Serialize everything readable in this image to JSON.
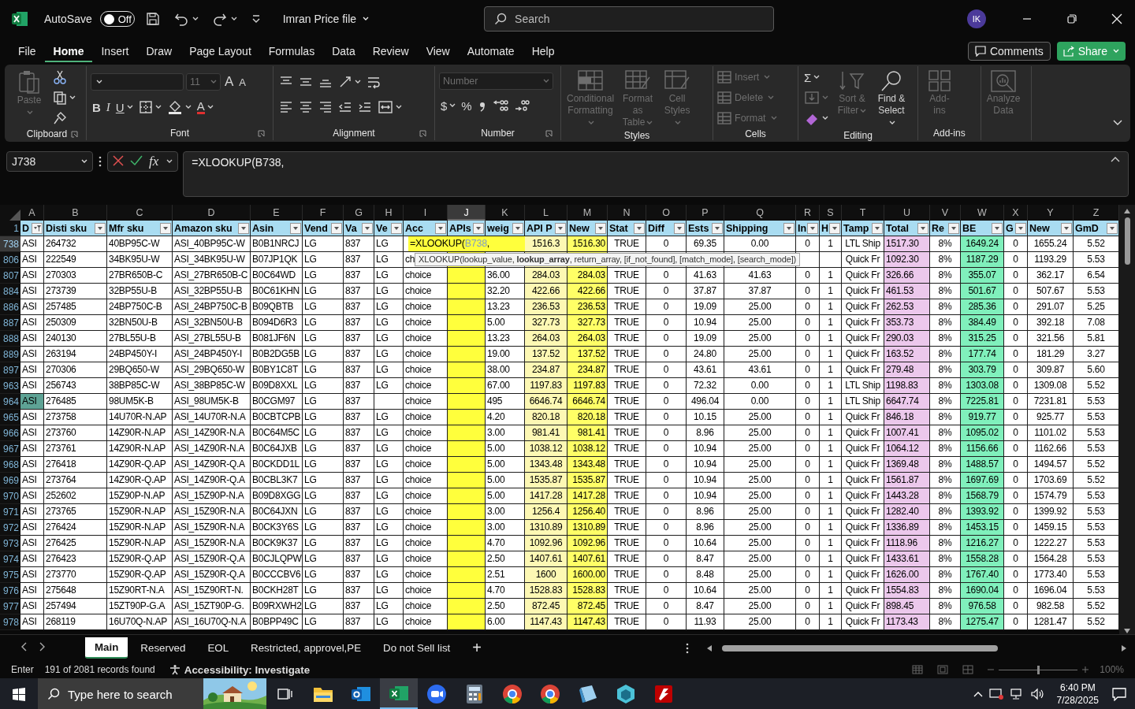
{
  "title_bar": {
    "autosave_label": "AutoSave",
    "autosave": {
      "on": false,
      "label": "Off"
    },
    "file_name": "Imran Price file",
    "search": {
      "placeholder": "Search"
    },
    "avatar": "IK"
  },
  "menu_tabs": [
    {
      "label": "File",
      "selected": false
    },
    {
      "label": "Home",
      "selected": true
    },
    {
      "label": "Insert",
      "selected": false
    },
    {
      "label": "Draw",
      "selected": false
    },
    {
      "label": "Page Layout",
      "selected": false
    },
    {
      "label": "Formulas",
      "selected": false
    },
    {
      "label": "Data",
      "selected": false
    },
    {
      "label": "Review",
      "selected": false
    },
    {
      "label": "View",
      "selected": false
    },
    {
      "label": "Automate",
      "selected": false
    },
    {
      "label": "Help",
      "selected": false
    }
  ],
  "comments_button": "Comments",
  "share_button": "Share",
  "ribbon": {
    "groups": [
      {
        "label": "Clipboard",
        "launcher": true,
        "columns": [
          [
            {
              "kind": "paste",
              "label": "Paste",
              "disabled": true,
              "dropdown": true
            }
          ],
          [
            {
              "kind": "cut",
              "disabled": false,
              "dropdown": false
            },
            {
              "kind": "copy",
              "disabled": false,
              "dropdown": true
            },
            {
              "kind": "format-painter",
              "disabled": false,
              "dropdown": false
            }
          ]
        ]
      },
      {
        "label": "Font",
        "launcher": true,
        "rows": [
          [
            {
              "kind": "font-name-field",
              "disabled": false,
              "dropdown": true
            },
            {
              "kind": "font-size-field",
              "value": "11",
              "disabled": true,
              "dropdown": true
            },
            {
              "kind": "grow",
              "text": "A",
              "disabled": false,
              "dropdown": false
            },
            {
              "kind": "shrink",
              "text": "A",
              "disabled": false,
              "dropdown": false
            }
          ],
          [
            {
              "kind": "bold",
              "text": "B",
              "disabled": false,
              "dropdown": false
            },
            {
              "kind": "italic",
              "text": "I",
              "disabled": false,
              "dropdown": false
            },
            {
              "kind": "underline",
              "text": "U",
              "disabled": false,
              "dropdown": true
            },
            {
              "kind": "borders",
              "disabled": false,
              "dropdown": true
            },
            {
              "kind": "fill-color",
              "disabled": false,
              "dropdown": true
            },
            {
              "kind": "font-color",
              "text": "A",
              "disabled": false,
              "dropdown": true
            }
          ]
        ]
      },
      {
        "label": "Alignment",
        "launcher": true,
        "rows": [
          [
            {
              "kind": "align-top",
              "disabled": false,
              "dropdown": false
            },
            {
              "kind": "align-middle",
              "disabled": false,
              "dropdown": false
            },
            {
              "kind": "align-bottom",
              "disabled": false,
              "dropdown": false
            },
            {
              "kind": "orientation",
              "disabled": false,
              "dropdown": true
            },
            {
              "kind": "wrap-text",
              "disabled": false,
              "dropdown": false
            }
          ],
          [
            {
              "kind": "align-left",
              "disabled": false,
              "dropdown": false
            },
            {
              "kind": "align-center",
              "disabled": false,
              "dropdown": false
            },
            {
              "kind": "align-right",
              "disabled": false,
              "dropdown": false
            },
            {
              "kind": "decrease-indent",
              "disabled": false,
              "dropdown": false
            },
            {
              "kind": "increase-indent",
              "disabled": false,
              "dropdown": false
            },
            {
              "kind": "merge",
              "disabled": false,
              "dropdown": true
            }
          ]
        ]
      },
      {
        "label": "Number",
        "launcher": true,
        "rows": [
          [
            {
              "kind": "format-field",
              "value": "Number",
              "disabled": true,
              "dropdown": true
            }
          ],
          [
            {
              "kind": "currency",
              "text": "$",
              "disabled": false,
              "dropdown": true
            },
            {
              "kind": "percent",
              "text": "%",
              "disabled": false,
              "dropdown": false
            },
            {
              "kind": "comma",
              "disabled": false,
              "dropdown": false
            },
            {
              "kind": "increase-decimal",
              "disabled": false,
              "dropdown": false
            },
            {
              "kind": "decrease-decimal",
              "disabled": false,
              "dropdown": false
            }
          ]
        ]
      },
      {
        "label": "Styles",
        "launcher": false,
        "columns": [
          [
            {
              "kind": "conditional-formatting",
              "label": "Conditional Formatting",
              "disabled": true,
              "dropdown": true
            }
          ],
          [
            {
              "kind": "format-as-table",
              "label": "Format as Table",
              "disabled": true,
              "dropdown": true
            }
          ],
          [
            {
              "kind": "cell-styles",
              "label": "Cell Styles",
              "disabled": true,
              "dropdown": true
            }
          ]
        ]
      },
      {
        "label": "Cells",
        "launcher": false,
        "columns": [
          [
            {
              "kind": "insert",
              "label": "Insert",
              "disabled": true,
              "dropdown": true
            },
            {
              "kind": "delete",
              "label": "Delete",
              "disabled": true,
              "dropdown": true
            },
            {
              "kind": "format",
              "label": "Format",
              "disabled": true,
              "dropdown": true
            }
          ]
        ]
      },
      {
        "label": "Editing",
        "launcher": false,
        "columns": [
          [
            {
              "kind": "autosum",
              "text": "Σ",
              "disabled": false,
              "dropdown": true
            },
            {
              "kind": "fill",
              "disabled": true,
              "dropdown": true
            },
            {
              "kind": "clear",
              "disabled": false,
              "dropdown": true
            }
          ],
          [
            {
              "kind": "sort-filter",
              "label": "Sort & Filter",
              "disabled": true,
              "dropdown": true
            }
          ],
          [
            {
              "kind": "find-select",
              "label": "Find & Select",
              "disabled": false,
              "dropdown": true
            }
          ]
        ]
      },
      {
        "label": "Add-ins",
        "launcher": false,
        "columns": [
          [
            {
              "kind": "add-ins",
              "label": "Add-ins",
              "disabled": true,
              "dropdown": false
            }
          ]
        ]
      },
      {
        "columns": [
          [
            {
              "kind": "analyze-data",
              "label": "Analyze Data",
              "disabled": true,
              "dropdown": false
            }
          ]
        ]
      }
    ]
  },
  "formula_bar": {
    "name_box": "J738",
    "function_button": "fx",
    "formula": "=XLOOKUP(B738,"
  },
  "table": {
    "header_row_number": "1",
    "columns": [
      {
        "letter": "A",
        "header": "D",
        "filtered": true,
        "selected": false
      },
      {
        "letter": "B",
        "header": "Disti sku",
        "filtered": false,
        "selected": false
      },
      {
        "letter": "C",
        "header": "Mfr sku",
        "filtered": false,
        "selected": false
      },
      {
        "letter": "D",
        "header": "Amazon sku",
        "filtered": false,
        "selected": false
      },
      {
        "letter": "E",
        "header": "Asin",
        "filtered": false,
        "selected": false
      },
      {
        "letter": "F",
        "header": "Vend",
        "filtered": false,
        "selected": false
      },
      {
        "letter": "G",
        "header": "Va",
        "filtered": false,
        "selected": false
      },
      {
        "letter": "H",
        "header": "Ve",
        "filtered": false,
        "selected": false
      },
      {
        "letter": "I",
        "header": "Acc",
        "filtered": false,
        "selected": false
      },
      {
        "letter": "J",
        "header": "APIs",
        "filtered": false,
        "selected": true,
        "color": "#ffff3c"
      },
      {
        "letter": "K",
        "header": "weig",
        "filtered": false,
        "selected": false
      },
      {
        "letter": "L",
        "header": "API P",
        "filtered": false,
        "selected": false,
        "color": "#fdf8b4"
      },
      {
        "letter": "M",
        "header": "New",
        "filtered": false,
        "selected": false,
        "color": "#ffff66"
      },
      {
        "letter": "N",
        "header": "Stat",
        "filtered": false,
        "selected": false
      },
      {
        "letter": "O",
        "header": "Diff",
        "filtered": false,
        "selected": false
      },
      {
        "letter": "P",
        "header": "Ests",
        "filtered": false,
        "selected": false
      },
      {
        "letter": "Q",
        "header": "Shipping",
        "filtered": false,
        "selected": false
      },
      {
        "letter": "R",
        "header": "In",
        "filtered": false,
        "selected": false
      },
      {
        "letter": "S",
        "header": "H",
        "filtered": false,
        "selected": false
      },
      {
        "letter": "T",
        "header": "Tamp",
        "filtered": false,
        "selected": false
      },
      {
        "letter": "U",
        "header": "Total",
        "filtered": false,
        "selected": false,
        "color": "#ecc8ec"
      },
      {
        "letter": "V",
        "header": "Re",
        "filtered": false,
        "selected": false
      },
      {
        "letter": "W",
        "header": "BE",
        "filtered": false,
        "selected": false,
        "color": "#80f0bc"
      },
      {
        "letter": "X",
        "header": "G",
        "filtered": false,
        "selected": false
      },
      {
        "letter": "Y",
        "header": "New",
        "filtered": false,
        "selected": false
      },
      {
        "letter": "Z",
        "header": "GmD",
        "filtered": false,
        "selected": false
      }
    ],
    "rows": [
      {
        "number": "738",
        "selected": true,
        "highlighted": false,
        "editor": {
          "text_before": "=XLOOKUP(",
          "reference": "B738",
          "text_after": ","
        },
        "cells": [
          "ASI",
          "264732",
          "40BP95C-W",
          "ASI_40BP95C-W",
          "B0B1NRCJ",
          "LG",
          "837",
          "LG",
          null,
          null,
          null,
          "1516.3",
          "1516.30",
          "TRUE",
          "0",
          "69.35",
          "0.00",
          "0",
          "1",
          "LTL Ship",
          "1517.30",
          "8%",
          "1649.24",
          "0",
          "1655.24",
          "5.52"
        ]
      },
      {
        "number": "806",
        "selected": false,
        "highlighted": false,
        "tooltip": "XLOOKUP(lookup_value, **lookup_array**, return_array, [if_not_found], [match_mode], [search_mode])",
        "cells": [
          "ASI",
          "222549",
          "34BK95U-W",
          "ASI_34BK95U-W",
          "B07JP1QK",
          "LG",
          "837",
          "LG",
          "ch",
          null,
          null,
          null,
          null,
          null,
          null,
          null,
          null,
          null,
          null,
          "Quick Fr",
          "1092.30",
          "8%",
          "1187.29",
          "0",
          "1193.29",
          "5.53"
        ]
      },
      {
        "number": "807",
        "selected": false,
        "highlighted": false,
        "cells": [
          "ASI",
          "270303",
          "27BR650B-C",
          "ASI_27BR650B-C",
          "B0C64WD",
          "LG",
          "837",
          "LG",
          "choice",
          null,
          "36.00",
          "284.03",
          "284.03",
          "TRUE",
          "0",
          "41.63",
          "41.63",
          "0",
          "1",
          "Quick Fr",
          "326.66",
          "8%",
          "355.07",
          "0",
          "362.17",
          "6.54"
        ]
      },
      {
        "number": "884",
        "selected": false,
        "highlighted": false,
        "cells": [
          "ASI",
          "273739",
          "32BP55U-B",
          "ASI_32BP55U-B",
          "B0C61KHN",
          "LG",
          "837",
          "LG",
          "choice",
          null,
          "32.20",
          "422.66",
          "422.66",
          "TRUE",
          "0",
          "37.87",
          "37.87",
          "0",
          "1",
          "Quick Fr",
          "461.53",
          "8%",
          "501.67",
          "0",
          "507.67",
          "5.53"
        ]
      },
      {
        "number": "886",
        "selected": false,
        "highlighted": false,
        "cells": [
          "ASI",
          "257485",
          "24BP750C-B",
          "ASI_24BP750C-B",
          "B09QBTB",
          "LG",
          "837",
          "LG",
          "choice",
          null,
          "13.23",
          "236.53",
          "236.53",
          "TRUE",
          "0",
          "19.09",
          "25.00",
          "0",
          "1",
          "Quick Fr",
          "262.53",
          "8%",
          "285.36",
          "0",
          "291.07",
          "5.25"
        ]
      },
      {
        "number": "887",
        "selected": false,
        "highlighted": false,
        "cells": [
          "ASI",
          "250309",
          "32BN50U-B",
          "ASI_32BN50U-B",
          "B094D6R3",
          "LG",
          "837",
          "LG",
          "choice",
          null,
          "5.00",
          "327.73",
          "327.73",
          "TRUE",
          "0",
          "10.94",
          "25.00",
          "0",
          "1",
          "Quick Fr",
          "353.73",
          "8%",
          "384.49",
          "0",
          "392.18",
          "7.08"
        ]
      },
      {
        "number": "888",
        "selected": false,
        "highlighted": false,
        "cells": [
          "ASI",
          "240130",
          "27BL55U-B",
          "ASI_27BL55U-B",
          "B081JF6N",
          "LG",
          "837",
          "LG",
          "choice",
          null,
          "13.23",
          "264.03",
          "264.03",
          "TRUE",
          "0",
          "19.09",
          "25.00",
          "0",
          "1",
          "Quick Fr",
          "290.03",
          "8%",
          "315.25",
          "0",
          "321.56",
          "5.81"
        ]
      },
      {
        "number": "889",
        "selected": false,
        "highlighted": false,
        "cells": [
          "ASI",
          "263194",
          "24BP450Y-I",
          "ASI_24BP450Y-I",
          "B0B2DG5B",
          "LG",
          "837",
          "LG",
          "choice",
          null,
          "19.00",
          "137.52",
          "137.52",
          "TRUE",
          "0",
          "24.80",
          "25.00",
          "0",
          "1",
          "Quick Fr",
          "163.52",
          "8%",
          "177.74",
          "0",
          "181.29",
          "3.27"
        ]
      },
      {
        "number": "897",
        "selected": false,
        "highlighted": false,
        "cells": [
          "ASI",
          "270306",
          "29BQ650-W",
          "ASI_29BQ650-W",
          "B0BY1C8T",
          "LG",
          "837",
          "LG",
          "choice",
          null,
          "38.00",
          "234.87",
          "234.87",
          "TRUE",
          "0",
          "43.61",
          "43.61",
          "0",
          "1",
          "Quick Fr",
          "279.48",
          "8%",
          "303.79",
          "0",
          "309.87",
          "5.60"
        ]
      },
      {
        "number": "963",
        "selected": false,
        "highlighted": false,
        "cells": [
          "ASI",
          "256743",
          "38BP85C-W",
          "ASI_38BP85C-W",
          "B09D8XXL",
          "LG",
          "837",
          "LG",
          "choice",
          null,
          "67.00",
          "1197.83",
          "1197.83",
          "TRUE",
          "0",
          "72.32",
          "0.00",
          "0",
          "1",
          "LTL Ship",
          "1198.83",
          "8%",
          "1303.08",
          "0",
          "1309.08",
          "5.52"
        ]
      },
      {
        "number": "964",
        "selected": false,
        "highlighted": true,
        "cells": [
          "ASI",
          "276485",
          "98UM5K-B",
          "ASI_98UM5K-B",
          "B0CGM97",
          "LG",
          "837",
          null,
          "choice",
          null,
          "495",
          "6646.74",
          "6646.74",
          "TRUE",
          "0",
          "496.04",
          "0.00",
          "0",
          "1",
          "LTL Ship",
          "6647.74",
          "8%",
          "7225.81",
          "0",
          "7231.81",
          "5.53"
        ]
      },
      {
        "number": "965",
        "selected": false,
        "highlighted": false,
        "cells": [
          "ASI",
          "273758",
          "14U70R-N.AP",
          "ASI_14U70R-N.A",
          "B0CBTCPB",
          "LG",
          "837",
          "LG",
          "choice",
          null,
          "4.20",
          "820.18",
          "820.18",
          "TRUE",
          "0",
          "10.15",
          "25.00",
          "0",
          "1",
          "Quick Fr",
          "846.18",
          "8%",
          "919.77",
          "0",
          "925.77",
          "5.53"
        ]
      },
      {
        "number": "966",
        "selected": false,
        "highlighted": false,
        "cells": [
          "ASI",
          "273760",
          "14Z90R-N.AP",
          "ASI_14Z90R-N.A",
          "B0C64M5C",
          "LG",
          "837",
          "LG",
          "choice",
          null,
          "3.00",
          "981.41",
          "981.41",
          "TRUE",
          "0",
          "8.96",
          "25.00",
          "0",
          "1",
          "Quick Fr",
          "1007.41",
          "8%",
          "1095.02",
          "0",
          "1101.02",
          "5.53"
        ]
      },
      {
        "number": "967",
        "selected": false,
        "highlighted": false,
        "cells": [
          "ASI",
          "273761",
          "14Z90R-N.AP",
          "ASI_14Z90R-N.A",
          "B0C64JXB",
          "LG",
          "837",
          "LG",
          "choice",
          null,
          "5.00",
          "1038.12",
          "1038.12",
          "TRUE",
          "0",
          "10.94",
          "25.00",
          "0",
          "1",
          "Quick Fr",
          "1064.12",
          "8%",
          "1156.66",
          "0",
          "1162.66",
          "5.53"
        ]
      },
      {
        "number": "968",
        "selected": false,
        "highlighted": false,
        "cells": [
          "ASI",
          "276418",
          "14Z90R-Q.AP",
          "ASI_14Z90R-Q.A",
          "B0CKDD1L",
          "LG",
          "837",
          "LG",
          "choice",
          null,
          "5.00",
          "1343.48",
          "1343.48",
          "TRUE",
          "0",
          "10.94",
          "25.00",
          "0",
          "1",
          "Quick Fr",
          "1369.48",
          "8%",
          "1488.57",
          "0",
          "1494.57",
          "5.52"
        ]
      },
      {
        "number": "969",
        "selected": false,
        "highlighted": false,
        "cells": [
          "ASI",
          "273764",
          "14Z90R-Q.AP",
          "ASI_14Z90R-Q.A",
          "B0CBL3K7",
          "LG",
          "837",
          "LG",
          "choice",
          null,
          "5.00",
          "1535.87",
          "1535.87",
          "TRUE",
          "0",
          "10.94",
          "25.00",
          "0",
          "1",
          "Quick Fr",
          "1561.87",
          "8%",
          "1697.69",
          "0",
          "1703.69",
          "5.52"
        ]
      },
      {
        "number": "970",
        "selected": false,
        "highlighted": false,
        "cells": [
          "ASI",
          "252602",
          "15Z90P-N.AP",
          "ASI_15Z90P-N.A",
          "B09D8XGG",
          "LG",
          "837",
          "LG",
          "choice",
          null,
          "5.00",
          "1417.28",
          "1417.28",
          "TRUE",
          "0",
          "10.94",
          "25.00",
          "0",
          "1",
          "Quick Fr",
          "1443.28",
          "8%",
          "1568.79",
          "0",
          "1574.79",
          "5.53"
        ]
      },
      {
        "number": "971",
        "selected": false,
        "highlighted": false,
        "cells": [
          "ASI",
          "273765",
          "15Z90R-N.AP",
          "ASI_15Z90R-N.A",
          "B0C64JXN",
          "LG",
          "837",
          "LG",
          "choice",
          null,
          "3.00",
          "1256.4",
          "1256.40",
          "TRUE",
          "0",
          "8.96",
          "25.00",
          "0",
          "1",
          "Quick Fr",
          "1282.40",
          "8%",
          "1393.92",
          "0",
          "1399.92",
          "5.53"
        ]
      },
      {
        "number": "972",
        "selected": false,
        "highlighted": false,
        "cells": [
          "ASI",
          "276424",
          "15Z90R-N.AP",
          "ASI_15Z90R-N.A",
          "B0CK3Y6S",
          "LG",
          "837",
          "LG",
          "choice",
          null,
          "3.00",
          "1310.89",
          "1310.89",
          "TRUE",
          "0",
          "8.96",
          "25.00",
          "0",
          "1",
          "Quick Fr",
          "1336.89",
          "8%",
          "1453.15",
          "0",
          "1459.15",
          "5.53"
        ]
      },
      {
        "number": "973",
        "selected": false,
        "highlighted": false,
        "cells": [
          "ASI",
          "276425",
          "15Z90R-N.AP",
          "ASI_15Z90R-N.A",
          "B0CK9K37",
          "LG",
          "837",
          "LG",
          "choice",
          null,
          "4.70",
          "1092.96",
          "1092.96",
          "TRUE",
          "0",
          "10.64",
          "25.00",
          "0",
          "1",
          "Quick Fr",
          "1118.96",
          "8%",
          "1216.27",
          "0",
          "1222.27",
          "5.53"
        ]
      },
      {
        "number": "974",
        "selected": false,
        "highlighted": false,
        "cells": [
          "ASI",
          "276423",
          "15Z90R-Q.AP",
          "ASI_15Z90R-Q.A",
          "B0CJLQPW",
          "LG",
          "837",
          "LG",
          "choice",
          null,
          "2.50",
          "1407.61",
          "1407.61",
          "TRUE",
          "0",
          "8.47",
          "25.00",
          "0",
          "1",
          "Quick Fr",
          "1433.61",
          "8%",
          "1558.28",
          "0",
          "1564.28",
          "5.53"
        ]
      },
      {
        "number": "975",
        "selected": false,
        "highlighted": false,
        "cells": [
          "ASI",
          "273770",
          "15Z90R-Q.AP",
          "ASI_15Z90R-Q.A",
          "B0CCCBV6",
          "LG",
          "837",
          "LG",
          "choice",
          null,
          "2.51",
          "1600",
          "1600.00",
          "TRUE",
          "0",
          "8.48",
          "25.00",
          "0",
          "1",
          "Quick Fr",
          "1626.00",
          "8%",
          "1767.40",
          "0",
          "1773.40",
          "5.53"
        ]
      },
      {
        "number": "976",
        "selected": false,
        "highlighted": false,
        "cells": [
          "ASI",
          "275648",
          "15Z90RT-N.A",
          "ASI_15Z90RT-N.",
          "B0CKH28T",
          "LG",
          "837",
          "LG",
          "choice",
          null,
          "4.70",
          "1528.83",
          "1528.83",
          "TRUE",
          "0",
          "10.64",
          "25.00",
          "0",
          "1",
          "Quick Fr",
          "1554.83",
          "8%",
          "1690.04",
          "0",
          "1696.04",
          "5.53"
        ]
      },
      {
        "number": "977",
        "selected": false,
        "highlighted": false,
        "cells": [
          "ASI",
          "257494",
          "15ZT90P-G.A",
          "ASI_15ZT90P-G.",
          "B09RXWH2",
          "LG",
          "837",
          "LG",
          "choice",
          null,
          "2.50",
          "872.45",
          "872.45",
          "TRUE",
          "0",
          "8.47",
          "25.00",
          "0",
          "1",
          "Quick Fr",
          "898.45",
          "8%",
          "976.58",
          "0",
          "982.58",
          "5.52"
        ]
      },
      {
        "number": "978",
        "selected": false,
        "highlighted": false,
        "cells": [
          "ASI",
          "268119",
          "16U70Q-N.AP",
          "ASI_16U70Q-N.A",
          "B0BPP49C",
          "LG",
          "837",
          "LG",
          "choice",
          null,
          "6.00",
          "1147.43",
          "1147.43",
          "TRUE",
          "0",
          "11.93",
          "25.00",
          "0",
          "1",
          "Quick Fr",
          "1173.43",
          "8%",
          "1275.47",
          "0",
          "1281.47",
          "5.52"
        ]
      }
    ]
  },
  "sheet_tabs": [
    {
      "label": "Main",
      "selected": true
    },
    {
      "label": "Reserved",
      "selected": false
    },
    {
      "label": "EOL",
      "selected": false
    },
    {
      "label": "Restricted, approvel,PE",
      "selected": false
    },
    {
      "label": "Do not Sell list",
      "selected": false
    }
  ],
  "new_sheet": "+",
  "status_bar": {
    "mode": "Enter",
    "records": "191 of 2081 records found",
    "accessibility": "Accessibility: Investigate",
    "zoom": {
      "level": 0.5,
      "reading": "100%"
    }
  },
  "taskbar": {
    "search": {
      "placeholder": "Type here to search"
    },
    "apps": [
      {
        "kind": "folder",
        "selected": false
      },
      {
        "kind": "mail",
        "selected": false
      },
      {
        "kind": "spreadsheet",
        "selected": true
      },
      {
        "kind": "video",
        "selected": false
      },
      {
        "kind": "calculator",
        "selected": false
      },
      {
        "kind": "browser",
        "selected": false
      },
      {
        "kind": "browser",
        "selected": false
      },
      {
        "kind": "notes",
        "selected": false
      },
      {
        "kind": "hexagon",
        "selected": false
      },
      {
        "kind": "ftp",
        "selected": false
      }
    ],
    "time": "6:40 PM",
    "date": "7/28/2025"
  }
}
